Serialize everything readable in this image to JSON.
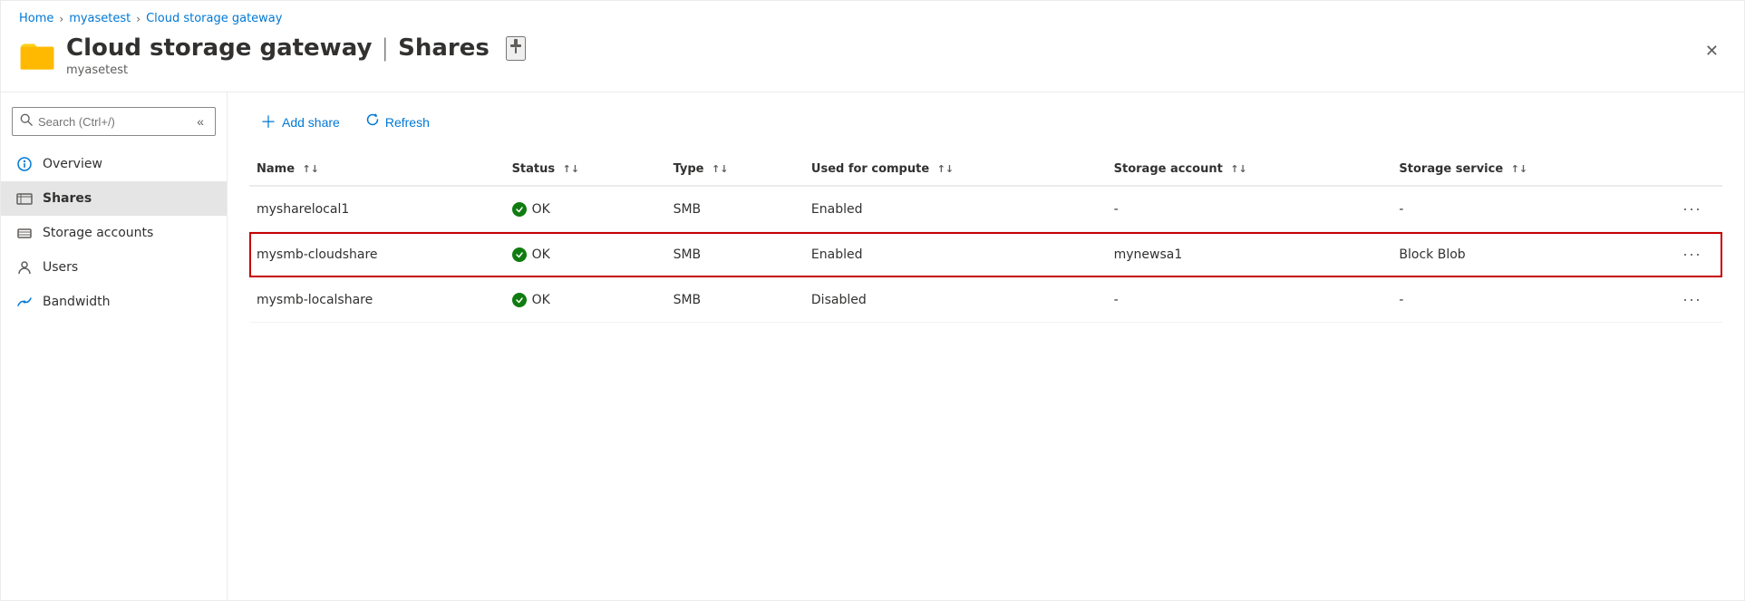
{
  "breadcrumb": {
    "home": "Home",
    "myasetest": "myasetest",
    "current": "Cloud storage gateway"
  },
  "header": {
    "title": "Cloud storage gateway",
    "separator": "|",
    "section": "Shares",
    "subtitle": "myasetest",
    "pin_icon": "pin-icon",
    "close_icon": "close-icon"
  },
  "search": {
    "placeholder": "Search (Ctrl+/)"
  },
  "sidebar": {
    "collapse_icon": "collapse-icon",
    "items": [
      {
        "id": "overview",
        "label": "Overview",
        "icon": "overview-icon"
      },
      {
        "id": "shares",
        "label": "Shares",
        "icon": "shares-icon"
      },
      {
        "id": "storage-accounts",
        "label": "Storage accounts",
        "icon": "storage-accounts-icon"
      },
      {
        "id": "users",
        "label": "Users",
        "icon": "users-icon"
      },
      {
        "id": "bandwidth",
        "label": "Bandwidth",
        "icon": "bandwidth-icon"
      }
    ]
  },
  "toolbar": {
    "add_share_label": "Add share",
    "refresh_label": "Refresh"
  },
  "table": {
    "columns": [
      {
        "id": "name",
        "label": "Name"
      },
      {
        "id": "status",
        "label": "Status"
      },
      {
        "id": "type",
        "label": "Type"
      },
      {
        "id": "used_for_compute",
        "label": "Used for compute"
      },
      {
        "id": "storage_account",
        "label": "Storage account"
      },
      {
        "id": "storage_service",
        "label": "Storage service"
      }
    ],
    "rows": [
      {
        "name": "mysharelocal1",
        "status": "OK",
        "type": "SMB",
        "used_for_compute": "Enabled",
        "storage_account": "-",
        "storage_service": "-",
        "highlighted": false
      },
      {
        "name": "mysmb-cloudshare",
        "status": "OK",
        "type": "SMB",
        "used_for_compute": "Enabled",
        "storage_account": "mynewsa1",
        "storage_service": "Block Blob",
        "highlighted": true
      },
      {
        "name": "mysmb-localshare",
        "status": "OK",
        "type": "SMB",
        "used_for_compute": "Disabled",
        "storage_account": "-",
        "storage_service": "-",
        "highlighted": false
      }
    ]
  },
  "colors": {
    "link": "#0078d4",
    "accent": "#0078d4",
    "highlight_border": "#c50000",
    "status_ok": "#107c10"
  }
}
